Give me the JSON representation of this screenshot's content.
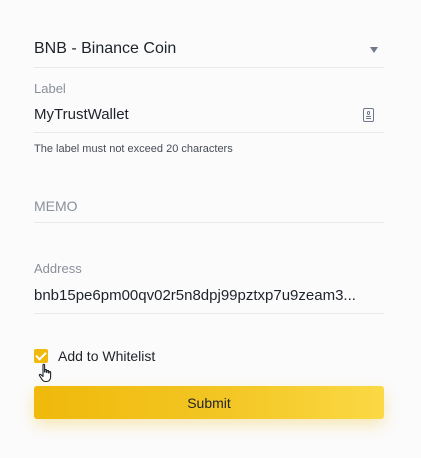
{
  "coin_select": {
    "value": "BNB - Binance Coin",
    "arrow_icon": "caret-down-icon"
  },
  "label_field": {
    "label": "Label",
    "value": "MyTrustWallet",
    "icon": "address-book-icon",
    "helper": "The label must not exceed 20 characters"
  },
  "memo_field": {
    "placeholder": "MEMO"
  },
  "address_field": {
    "label": "Address",
    "value": "bnb15pe6pm00qv02r5n8dpj99pztxp7u9zeam3..."
  },
  "whitelist": {
    "label": "Add to Whitelist",
    "checked": true
  },
  "submit": {
    "label": "Submit"
  },
  "colors": {
    "accent": "#f0b90b",
    "accent_light": "#fbd944",
    "text": "#1e2329",
    "muted": "#8a9099",
    "divider": "#e6e8ea"
  }
}
